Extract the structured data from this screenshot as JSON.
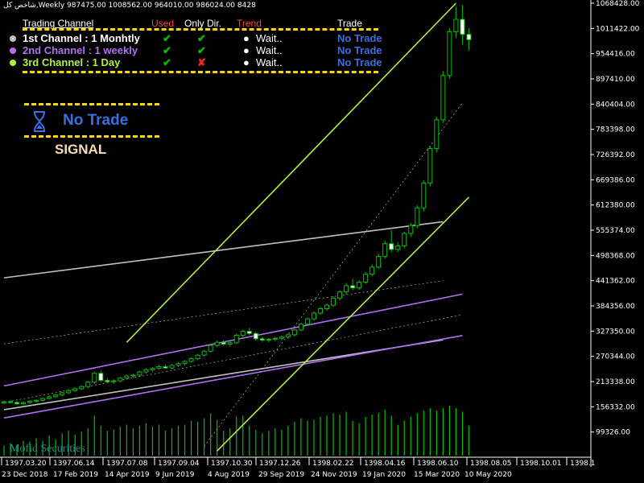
{
  "header": {
    "title": "شاخص کل,Weekly  987475.00 1008562.00 964010.00 986024.00  8428"
  },
  "panel": {
    "columns": {
      "channel": "Trading Channel",
      "used": "Used",
      "only_dir": "Only Dir.",
      "trend": "Trend",
      "trade": "Trade"
    },
    "rows": [
      {
        "color": "#C0C0C0",
        "label": "1st Channel   : 1 Monhtly",
        "used": "✔",
        "only_dir": "✔",
        "only_dir_color": "#00C000",
        "trend": "Wait..",
        "trade": "No Trade",
        "label_color": "#FFFFFF"
      },
      {
        "color": "#B070F0",
        "label": "2nd Channel  : 1 weekly",
        "used": "✔",
        "only_dir": "✔",
        "only_dir_color": "#00C000",
        "trend": "Wait..",
        "trade": "No Trade",
        "label_color": "#B070F0"
      },
      {
        "color": "#B0F040",
        "label": "3rd Channel  : 1 Day",
        "used": "✔",
        "only_dir": "✘",
        "only_dir_color": "#FF2020",
        "trend": "Wait..",
        "trade": "No Trade",
        "label_color": "#B0F040"
      }
    ],
    "status_icon": "hourglass-icon",
    "status_text": "No Trade",
    "signal_label": "SIGNAL",
    "watermark": "Mofid Securities"
  },
  "colors": {
    "accent": "#FFD700",
    "no_trade": "#3A6FE0",
    "bull": "#00C000",
    "used": "#FF4040",
    "trend": "#FF4040"
  },
  "chart_data": {
    "type": "candlestick",
    "title": "شاخص کل,Weekly",
    "ylim": [
      42300,
      1068428
    ],
    "yticks": [
      99326,
      156332,
      213338,
      270344,
      327350,
      384356,
      441362,
      498368,
      555374,
      612380,
      669386,
      726392,
      783398,
      840404,
      897410,
      954416,
      1011422,
      1068428
    ],
    "ytick_labels": [
      "99326.00",
      "156332.00",
      "213338.00",
      "270344.00",
      "327350.00",
      "384356.00",
      "441362.00",
      "498368.00",
      "555374.00",
      "612380.00",
      "669386.00",
      "726392.00",
      "783398.00",
      "840404.00",
      "897410.00",
      "954416.00",
      "1011422.00",
      "1068428.00"
    ],
    "x_greg": [
      "23 Dec 2018",
      "17 Feb 2019",
      "14 Apr 2019",
      "9 Jun 2019",
      "4 Aug 2019",
      "29 Sep 2019",
      "24 Nov 2019",
      "19 Jan 2020",
      "15 Mar 2020",
      "10 May 2020"
    ],
    "x_jalali": [
      "1397.03.20",
      "1397.06.14",
      "1397.07.08",
      "1397.09.04",
      "1397.10.30",
      "1397.12.26",
      "1398.02.22",
      "1398.04.16",
      "1398.06.10",
      "1398.08.05",
      "1398.10.01",
      "1398.1"
    ],
    "candles": [
      [
        165000,
        170000,
        162000,
        168000
      ],
      [
        168000,
        172000,
        164000,
        166000
      ],
      [
        166000,
        170000,
        161000,
        163000
      ],
      [
        163000,
        168000,
        160000,
        166000
      ],
      [
        166000,
        171000,
        163000,
        169000
      ],
      [
        169000,
        174000,
        166000,
        171000
      ],
      [
        171000,
        177000,
        168000,
        175000
      ],
      [
        175000,
        182000,
        172000,
        179000
      ],
      [
        179000,
        186000,
        176000,
        183000
      ],
      [
        183000,
        190000,
        180000,
        188000
      ],
      [
        188000,
        196000,
        185000,
        193000
      ],
      [
        193000,
        200000,
        190000,
        197000
      ],
      [
        197000,
        205000,
        194000,
        202000
      ],
      [
        202000,
        215000,
        198000,
        212000
      ],
      [
        212000,
        236000,
        208000,
        232000
      ],
      [
        232000,
        238000,
        212000,
        216000
      ],
      [
        216000,
        222000,
        209000,
        213000
      ],
      [
        213000,
        219000,
        208000,
        215000
      ],
      [
        215000,
        224000,
        211000,
        221000
      ],
      [
        221000,
        229000,
        218000,
        226000
      ],
      [
        226000,
        231000,
        222000,
        228000
      ],
      [
        228000,
        238000,
        225000,
        235000
      ],
      [
        235000,
        244000,
        231000,
        240000
      ],
      [
        240000,
        246000,
        236000,
        243000
      ],
      [
        243000,
        251000,
        240000,
        247000
      ],
      [
        247000,
        252000,
        242000,
        244000
      ],
      [
        244000,
        253000,
        241000,
        250000
      ],
      [
        250000,
        257000,
        246000,
        254000
      ],
      [
        254000,
        262000,
        250000,
        259000
      ],
      [
        259000,
        268000,
        256000,
        265000
      ],
      [
        265000,
        276000,
        262000,
        273000
      ],
      [
        273000,
        285000,
        270000,
        282000
      ],
      [
        282000,
        298000,
        279000,
        295000
      ],
      [
        295000,
        306000,
        291000,
        302000
      ],
      [
        302000,
        307000,
        294000,
        298000
      ],
      [
        298000,
        305000,
        292000,
        301000
      ],
      [
        301000,
        322000,
        298000,
        318000
      ],
      [
        318000,
        331000,
        314000,
        327000
      ],
      [
        327000,
        335000,
        318000,
        322000
      ],
      [
        322000,
        326000,
        306000,
        310000
      ],
      [
        310000,
        314000,
        303000,
        307000
      ],
      [
        307000,
        312000,
        302000,
        309000
      ],
      [
        309000,
        314000,
        304000,
        311000
      ],
      [
        311000,
        318000,
        307000,
        314000
      ],
      [
        314000,
        322000,
        310000,
        319000
      ],
      [
        319000,
        333000,
        315000,
        330000
      ],
      [
        330000,
        346000,
        327000,
        343000
      ],
      [
        343000,
        358000,
        339000,
        355000
      ],
      [
        355000,
        372000,
        351000,
        368000
      ],
      [
        368000,
        382000,
        364000,
        378000
      ],
      [
        378000,
        390000,
        373000,
        386000
      ],
      [
        386000,
        406000,
        382000,
        402000
      ],
      [
        402000,
        420000,
        397000,
        416000
      ],
      [
        416000,
        436000,
        410000,
        430000
      ],
      [
        430000,
        446000,
        420000,
        425000
      ],
      [
        425000,
        442000,
        420000,
        438000
      ],
      [
        438000,
        461000,
        434000,
        456000
      ],
      [
        456000,
        478000,
        451000,
        472000
      ],
      [
        472000,
        502000,
        468000,
        496000
      ],
      [
        496000,
        532000,
        491000,
        525000
      ],
      [
        525000,
        556000,
        505000,
        512000
      ],
      [
        512000,
        528000,
        506000,
        520000
      ],
      [
        520000,
        552000,
        515000,
        548000
      ],
      [
        548000,
        572000,
        540000,
        566000
      ],
      [
        566000,
        612000,
        560000,
        606000
      ],
      [
        606000,
        668000,
        598000,
        662000
      ],
      [
        662000,
        745000,
        655000,
        740000
      ],
      [
        740000,
        812000,
        732000,
        805000
      ],
      [
        805000,
        915000,
        798000,
        905000
      ],
      [
        905000,
        1012000,
        898000,
        1004000
      ],
      [
        1004000,
        1060000,
        990000,
        1032000
      ],
      [
        1032000,
        1064000,
        975000,
        998000
      ],
      [
        998000,
        1012000,
        962000,
        986000
      ]
    ],
    "volume": [
      0.2,
      0.25,
      0.22,
      0.3,
      0.28,
      0.35,
      0.3,
      0.4,
      0.32,
      0.45,
      0.5,
      0.42,
      0.48,
      0.55,
      0.8,
      0.6,
      0.5,
      0.52,
      0.58,
      0.62,
      0.55,
      0.6,
      0.65,
      0.58,
      0.62,
      0.5,
      0.55,
      0.6,
      0.62,
      0.7,
      0.68,
      0.75,
      0.85,
      0.72,
      0.5,
      0.55,
      0.78,
      0.8,
      0.6,
      0.52,
      0.45,
      0.5,
      0.55,
      0.52,
      0.6,
      0.68,
      0.75,
      0.7,
      0.72,
      0.78,
      0.8,
      0.85,
      0.82,
      0.88,
      0.7,
      0.65,
      0.78,
      0.82,
      0.86,
      0.92,
      0.8,
      0.62,
      0.7,
      0.78,
      0.85,
      0.9,
      0.95,
      0.9,
      0.95,
      1.0,
      0.95,
      0.88,
      0.6
    ],
    "channels": [
      {
        "name": "1st Channel",
        "color": "#C0C0C0",
        "lines": [
          {
            "points": [
              [
                0,
                447800
              ],
              [
                68,
                574600
              ]
            ],
            "style": "solid"
          },
          {
            "points": [
              [
                0,
                149700
              ],
              [
                68,
                307500
              ]
            ],
            "style": "solid"
          },
          {
            "points": [
              [
                0,
                298400
              ],
              [
                68,
                441100
              ]
            ],
            "style": "dash"
          }
        ]
      },
      {
        "name": "2nd Channel",
        "color": "#B070F0",
        "lines": [
          {
            "points": [
              [
                0,
                203500
              ],
              [
                71,
                411000
              ]
            ],
            "style": "solid"
          },
          {
            "points": [
              [
                0,
                131100
              ],
              [
                71,
                317300
              ]
            ],
            "style": "solid"
          },
          {
            "points": [
              [
                0,
                166100
              ],
              [
                71,
                364200
              ]
            ],
            "style": "dash"
          }
        ]
      },
      {
        "name": "3rd Channel",
        "color": "#B0F040",
        "lines": [
          {
            "points": [
              [
                19,
                302000
              ],
              [
                70,
                1068428
              ]
            ],
            "style": "solid"
          },
          {
            "points": [
              [
                33,
                56500
              ],
              [
                72,
                630000
              ]
            ],
            "style": "solid"
          },
          {
            "points": [
              [
                31,
                67000
              ],
              [
                71,
                843000
              ]
            ],
            "style": "dash"
          }
        ]
      }
    ]
  }
}
